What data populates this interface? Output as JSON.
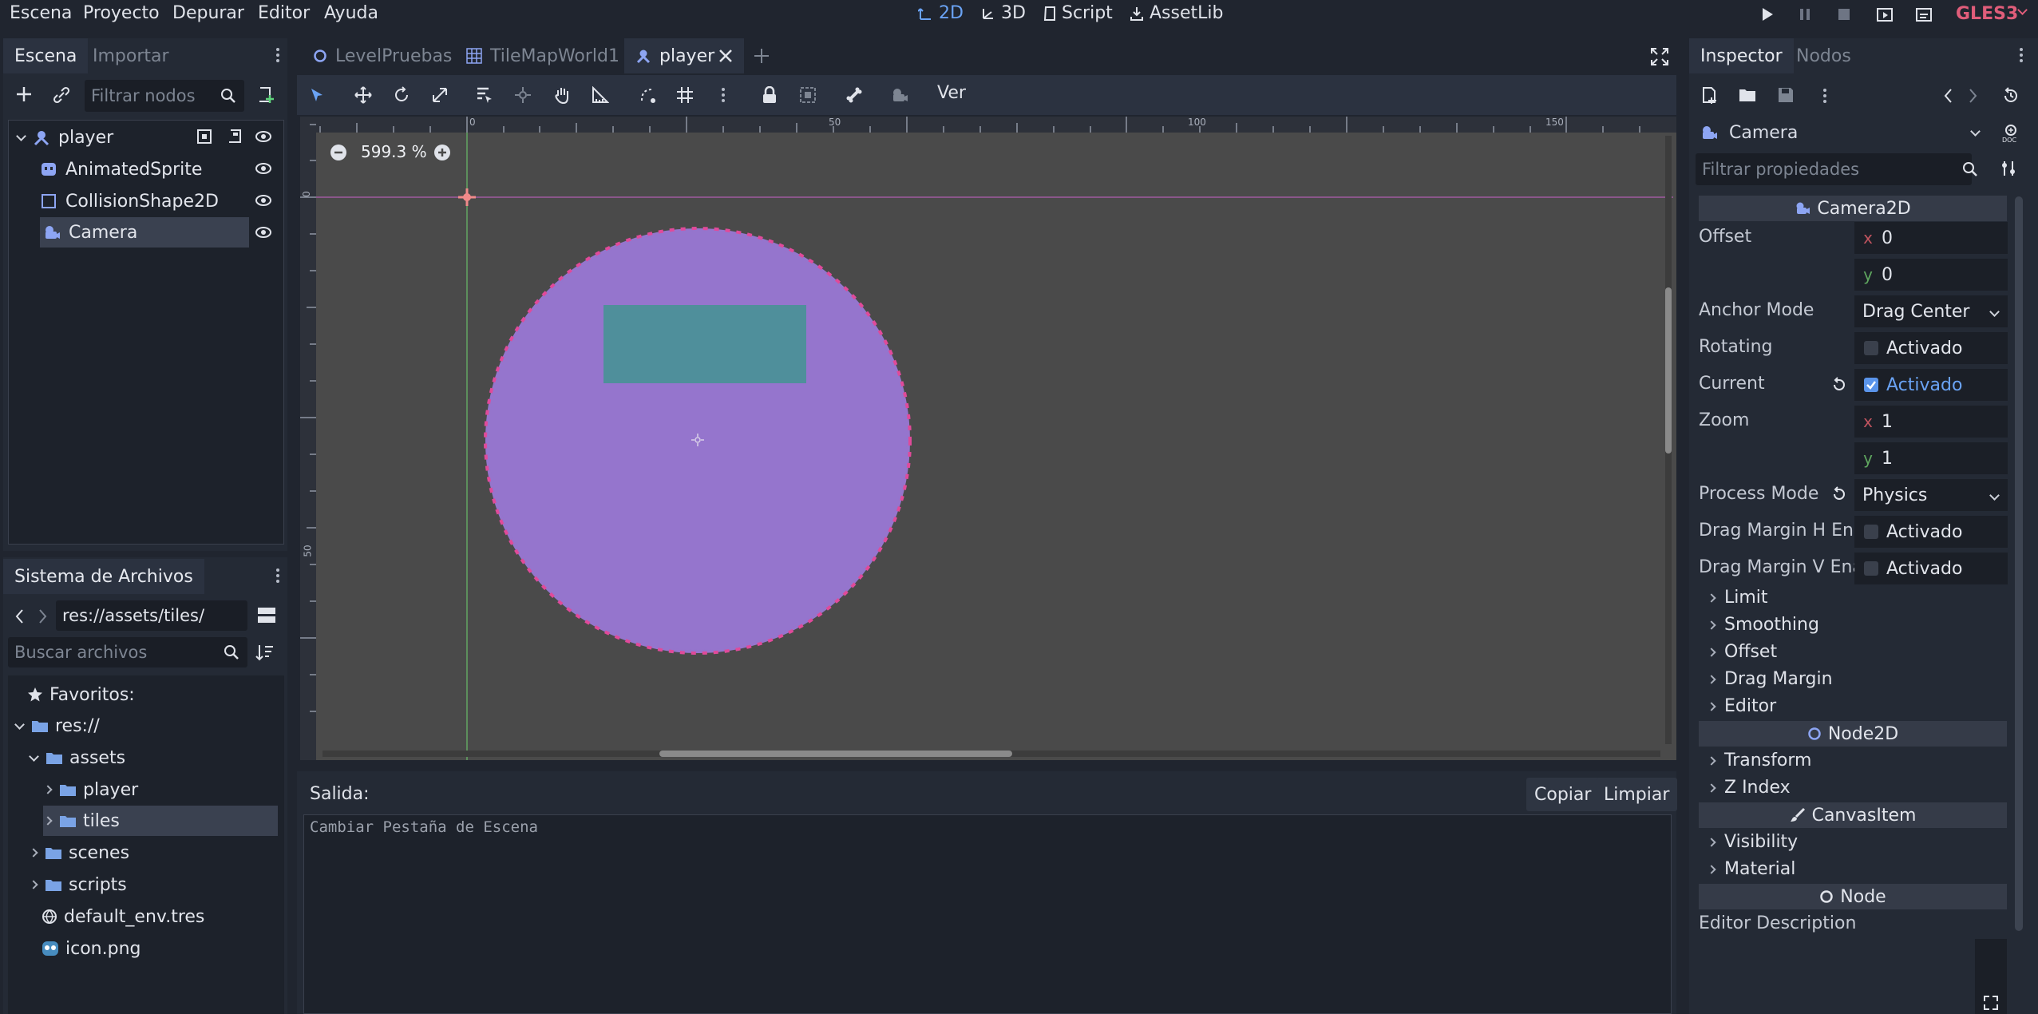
{
  "menu": [
    "Escena",
    "Proyecto",
    "Depurar",
    "Editor",
    "Ayuda"
  ],
  "modes": [
    {
      "label": "2D",
      "icon": "2d-icon",
      "active": true
    },
    {
      "label": "3D",
      "icon": "3d-icon"
    },
    {
      "label": "Script",
      "icon": "script-icon"
    },
    {
      "label": "AssetLib",
      "icon": "assetlib-icon"
    }
  ],
  "renderer": "GLES3",
  "scene_dock": {
    "tabs": [
      "Escena",
      "Importar"
    ],
    "filter_placeholder": "Filtrar nodos",
    "nodes": [
      "player",
      "AnimatedSprite",
      "CollisionShape2D",
      "Camera"
    ]
  },
  "filesystem": {
    "title": "Sistema de Archivos",
    "path": "res://assets/tiles/",
    "search_placeholder": "Buscar archivos",
    "items": [
      "Favoritos:",
      "res://",
      "assets",
      "player",
      "tiles",
      "scenes",
      "scripts",
      "default_env.tres",
      "icon.png"
    ]
  },
  "editor_tabs": [
    "LevelPruebas",
    "TileMapWorld1",
    "player"
  ],
  "toolbar": {
    "view_label": "Ver"
  },
  "viewport": {
    "zoom": "599.3 %",
    "ruler_ticks": [
      "0",
      "50",
      "100",
      "150"
    ],
    "vruler_ticks": [
      "0",
      "50"
    ]
  },
  "output": {
    "title": "Salida:",
    "copy": "Copiar",
    "clear": "Limpiar",
    "log": "Cambiar Pestaña de Escena"
  },
  "inspector": {
    "tabs": [
      "Inspector",
      "Nodos"
    ],
    "node_name": "Camera",
    "filter_placeholder": "Filtrar propiedades",
    "class_camera": "Camera2D",
    "props": {
      "offset": "Offset",
      "offset_x": "0",
      "offset_y": "0",
      "anchor_mode": "Anchor Mode",
      "anchor_value": "Drag Center",
      "rotating": "Rotating",
      "current": "Current",
      "zoom": "Zoom",
      "zoom_x": "1",
      "zoom_y": "1",
      "process_mode": "Process Mode",
      "process_value": "Physics",
      "drag_h": "Drag Margin H En",
      "drag_v": "Drag Margin V Ena",
      "activado": "Activado"
    },
    "groups_camera": [
      "Limit",
      "Smoothing",
      "Offset",
      "Drag Margin",
      "Editor"
    ],
    "class_node2d": "Node2D",
    "groups_node2d": [
      "Transform",
      "Z Index"
    ],
    "class_canvas": "CanvasItem",
    "groups_canvas": [
      "Visibility",
      "Material"
    ],
    "class_node": "Node",
    "editor_description": "Editor Description"
  },
  "colors": {
    "accent": "#5a94ea",
    "sprite": "#9575cd",
    "rect": "#4f8f9b"
  }
}
